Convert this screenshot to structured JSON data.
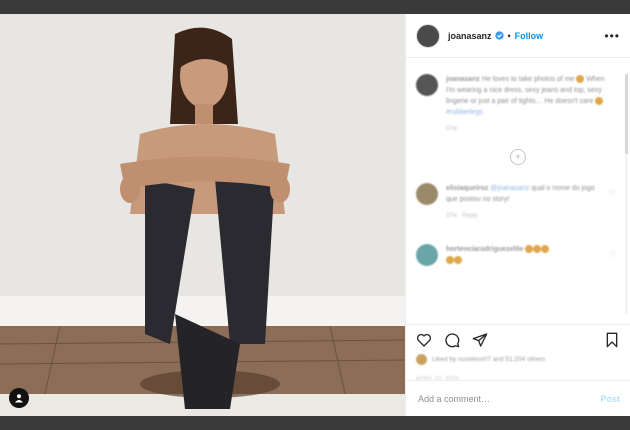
{
  "header": {
    "username": "joanasanz",
    "follow_label": "Follow",
    "separator": "•",
    "more_label": "•••"
  },
  "caption": {
    "username": "joanasanz",
    "text": "He loves to take photos of me ",
    "text2": " When I'm wearing a nice dress, sexy jeans and top, sexy lingerie or just a pair of tights… He doesn't care ",
    "hashtag": "#rubberlegs",
    "time": "37w"
  },
  "load_more_label": "+",
  "comments": [
    {
      "username": "elisiaqueiroz",
      "mention": "@joanasanz",
      "text": " qual o nome do jogo que postou no story!",
      "time": "37w",
      "reply_label": "Reply"
    },
    {
      "username": "hortenciarodriguezelite"
    }
  ],
  "likes": {
    "text": "Liked by nuseless07 and 51,204 others"
  },
  "date": "APRIL 22, 2020",
  "add_comment": {
    "placeholder": "Add a comment…",
    "post_label": "Post"
  },
  "colors": {
    "accent": "#0095f6",
    "post_disabled": "#b2dffc",
    "backdrop": "#3a3a3a"
  }
}
